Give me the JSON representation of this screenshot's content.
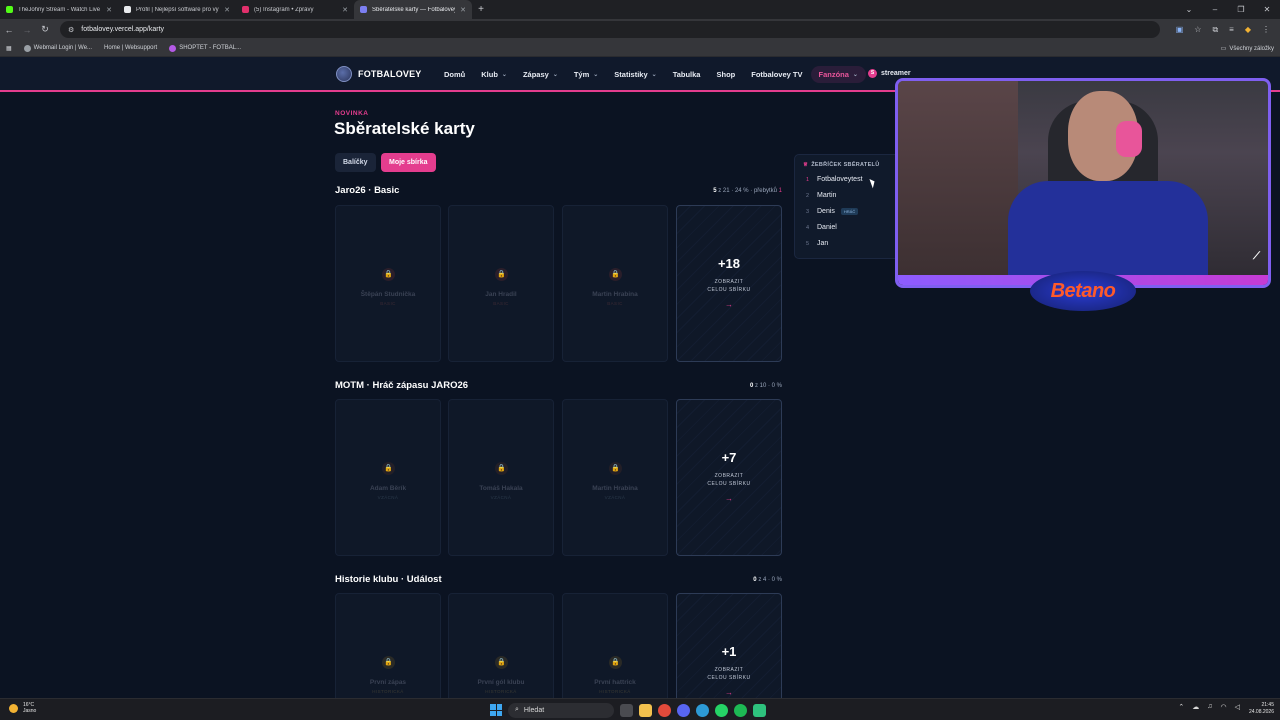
{
  "browser": {
    "tabs": [
      {
        "title": "TheJohny Stream - Watch Live o",
        "color": "#53fc18"
      },
      {
        "title": "Profil | Nejlepší software pro vý",
        "color": "#e8eaed"
      },
      {
        "title": "(5) Instagram • Zprávy",
        "color": "#e1306c"
      },
      {
        "title": "Sběratelské karty — Fotbalovey",
        "color": "#7c7ff2"
      }
    ],
    "url": "fotbalovey.vercel.app/karty",
    "bookmarks": [
      "Webmail Login | We...",
      "Home | Websupport",
      "SHOPTET - FOTBAL..."
    ],
    "bookmarks_right": "Všechny záložky"
  },
  "site": {
    "logo": "FOTBALOVEY",
    "menu": [
      "Domů",
      "Klub",
      "Zápasy",
      "Tým",
      "Statistiky",
      "Tabulka",
      "Shop",
      "Fotbalovey TV",
      "Fanzóna"
    ],
    "user_initial": "S",
    "user_name": "streamer",
    "kicker": "NOVINKA",
    "title": "Sběratelské karty",
    "tabs": [
      "Balíčky",
      "Moje sbírka"
    ],
    "sections": [
      {
        "title": "Jaro26 · Basic",
        "owned": "5",
        "stat": "z 21 · 24 %",
        "dup_label": "· přebytků",
        "dup": "1",
        "cards": [
          {
            "name": "Štěpán Studnička",
            "rarity": "BASIC"
          },
          {
            "name": "Jan Hradil",
            "rarity": "BASIC"
          },
          {
            "name": "Martin Hrabina",
            "rarity": "BASIC"
          }
        ],
        "more": "+18"
      },
      {
        "title": "MOTM · Hráč zápasu JARO26",
        "owned": "0",
        "stat": "z 10 · 0 %",
        "cards": [
          {
            "name": "Adam Běrík",
            "rarity": "VZÁCNÁ"
          },
          {
            "name": "Tomáš Hakala",
            "rarity": "VZÁCNÁ"
          },
          {
            "name": "Martin Hrabina",
            "rarity": "VZÁCNÁ"
          }
        ],
        "more": "+7"
      },
      {
        "title": "Historie klubu · Událost",
        "owned": "0",
        "stat": "z 4 · 0 %",
        "cards": [
          {
            "name": "První zápas",
            "rarity": "HISTORICKÁ"
          },
          {
            "name": "První gól klubu",
            "rarity": "HISTORICKÁ"
          },
          {
            "name": "První hattrick",
            "rarity": "HISTORICKÁ"
          }
        ],
        "more": "+1"
      }
    ],
    "more_label_1": "ZOBRAZIT",
    "more_label_2": "CELOU SBÍRKU",
    "leaderboard": {
      "title": "ŽEBŘÍČEK SBĚRATELŮ",
      "rows": [
        {
          "rank": "1",
          "name": "Fotbaloveytest"
        },
        {
          "rank": "2",
          "name": "Martin"
        },
        {
          "rank": "3",
          "name": "Denis",
          "badge": "HRÁČ"
        },
        {
          "rank": "4",
          "name": "Daniel"
        },
        {
          "rank": "5",
          "name": "Jan"
        }
      ]
    }
  },
  "overlay": {
    "sponsor": "Betano"
  },
  "taskbar": {
    "temp": "16°C",
    "weather": "Jasno",
    "search": "Hledat",
    "time": "21:45",
    "date": "24.08.2026"
  }
}
